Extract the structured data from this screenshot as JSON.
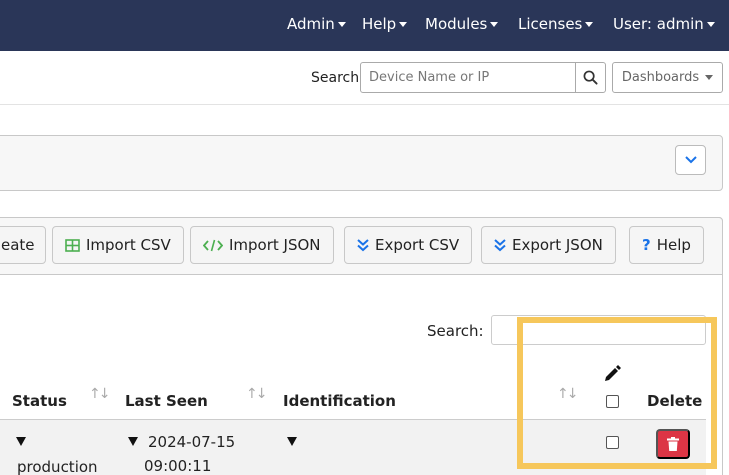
{
  "navbar": {
    "items": [
      {
        "label": "Admin"
      },
      {
        "label": "Help"
      },
      {
        "label": "Modules"
      },
      {
        "label": "Licenses"
      },
      {
        "label": "User: admin"
      }
    ]
  },
  "search": {
    "label": "Search",
    "placeholder": "Device Name or IP",
    "dashboards_label": "Dashboards"
  },
  "toolbar": {
    "buttons": [
      {
        "label": "eate"
      },
      {
        "label": "Import CSV"
      },
      {
        "label": "Import JSON"
      },
      {
        "label": "Export CSV"
      },
      {
        "label": "Export JSON"
      },
      {
        "label": "Help"
      }
    ]
  },
  "table": {
    "search_label": "Search:",
    "columns": {
      "status": "Status",
      "last_seen": "Last Seen",
      "identification": "Identification",
      "delete": "Delete"
    },
    "rows": [
      {
        "status": "production",
        "last_seen_date": "2024-07-15",
        "last_seen_time": "09:00:11"
      }
    ]
  },
  "colors": {
    "navbar": "#2a3658",
    "delete": "#dc3545",
    "highlight": "#f6c75b"
  }
}
